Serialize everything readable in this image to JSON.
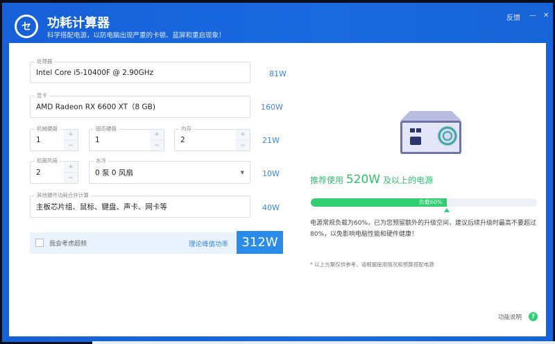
{
  "header": {
    "title": "功耗计算器",
    "subtitle": "科学搭配电源，以防电脑出现严重的卡顿、蓝屏和重启现象！",
    "logo_text": "セ",
    "feedback": "反馈",
    "minimize": "—",
    "close": "✕"
  },
  "form": {
    "cpu": {
      "label": "处理器",
      "value": "Intel Core i5-10400F @ 2.90GHz",
      "watt": "81W"
    },
    "gpu": {
      "label": "显卡",
      "value": "AMD Radeon RX 6600 XT（8 GB)",
      "watt": "160W"
    },
    "hdd": {
      "label": "机械硬盘",
      "value": "1"
    },
    "ssd": {
      "label": "固态硬盘",
      "value": "1"
    },
    "ram": {
      "label": "内存",
      "value": "2"
    },
    "storage_watt": "21W",
    "fan": {
      "label": "机箱风扇",
      "value": "2"
    },
    "water": {
      "label": "水冷",
      "value": "0 泵 0 风扇"
    },
    "cooling_watt": "10W",
    "other": {
      "label": "其他硬件功耗合并计算",
      "value": "主板芯片组、鼠标、键盘、声卡、网卡等",
      "watt": "40W"
    },
    "plus": "+",
    "minus": "−",
    "caret": "▼",
    "overclock_label": "我会考虑超频",
    "overclock_checked": false,
    "peak_label": "理论峰值功率",
    "total": "312W"
  },
  "result": {
    "rec_prefix": "推荐使用",
    "rec_watt": "520W",
    "rec_suffix": "及以上的电源",
    "load_label": "负载60%",
    "load_percent": 60,
    "description": "电源常规负载为60%，已为您预留额外的升级空间，建议后续升级时最高不要超过80%，以免影响电脑性能和硬件健康！",
    "note": "* 以上方案仅供参考，请根据使用情况和预算搭配电源",
    "help_label": "功能说明",
    "help_icon": "?"
  },
  "colors": {
    "brand": "#1a6ae0",
    "accent": "#2a8ce8",
    "green": "#2fcf72"
  }
}
